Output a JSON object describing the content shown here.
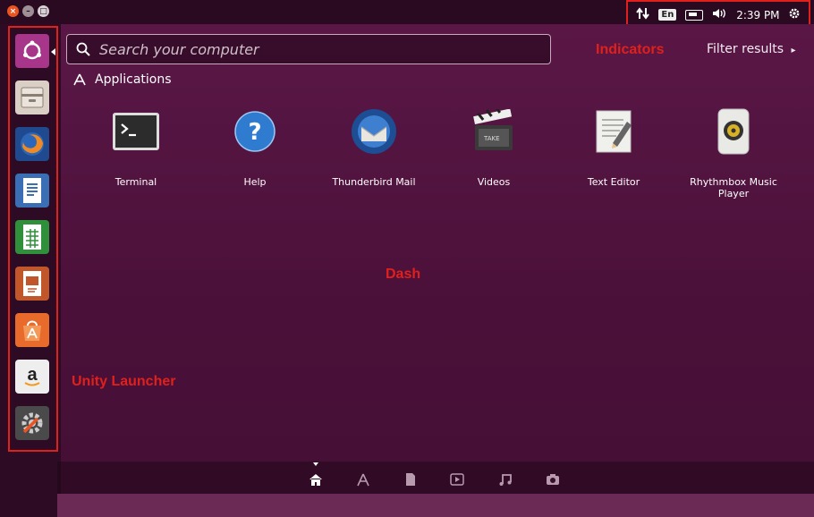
{
  "top_panel": {
    "window_buttons": {
      "close": "×",
      "minimize": "–",
      "maximize": "□"
    },
    "indicators": {
      "language": "En",
      "clock": "2:39 PM"
    }
  },
  "dash": {
    "search_placeholder": "Search your computer",
    "filter_label": "Filter results",
    "filter_arrow": "▸",
    "section_title": "Applications",
    "apps": [
      {
        "label": "Terminal",
        "icon": "terminal-icon"
      },
      {
        "label": "Help",
        "icon": "help-icon"
      },
      {
        "label": "Thunderbird Mail",
        "icon": "thunderbird-icon"
      },
      {
        "label": "Videos",
        "icon": "videos-icon"
      },
      {
        "label": "Text Editor",
        "icon": "text-editor-icon"
      },
      {
        "label": "Rhythmbox Music Player",
        "icon": "rhythmbox-icon"
      }
    ],
    "lenses": [
      "home-lens-icon",
      "applications-lens-icon",
      "files-lens-icon",
      "video-lens-icon",
      "music-lens-icon",
      "photo-lens-icon"
    ]
  },
  "annotations": {
    "indicators": "Indicators",
    "dash": "Dash",
    "launcher": "Unity Launcher"
  },
  "launcher": {
    "items": [
      "dash-home-icon",
      "files-icon",
      "firefox-icon",
      "writer-icon",
      "calc-icon",
      "impress-icon",
      "software-center-icon",
      "amazon-icon",
      "system-settings-icon"
    ]
  },
  "colors": {
    "accent": "#e95420",
    "annotation_red": "#e0201a",
    "dash_bg": "#4a1039"
  }
}
